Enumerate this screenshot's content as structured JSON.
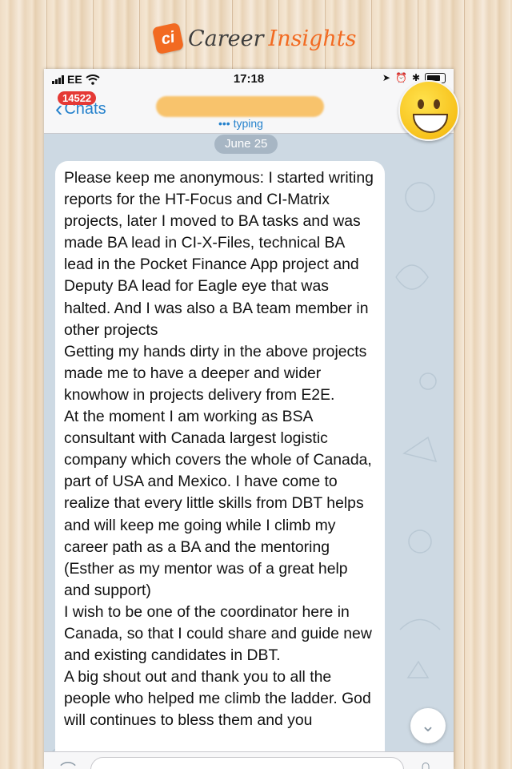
{
  "brand": {
    "badge": "ci",
    "word1": "Career",
    "word2": "Insights"
  },
  "status_bar": {
    "carrier": "EE",
    "time": "17:18"
  },
  "nav": {
    "badge_count": "14522",
    "back_label": "Chats",
    "status": "typing"
  },
  "chat": {
    "date": "June 25",
    "message": "Please keep me anonymous: I started writing reports for the HT-Focus and CI-Matrix projects, later I moved to BA tasks and was made BA lead in CI-X-Files, technical BA lead in the Pocket Finance App project and Deputy BA lead for Eagle eye that was halted. And I was also a BA team member in other projects\nGetting my hands dirty in the above projects made me to have a deeper and wider knowhow in projects delivery from E2E.\nAt the moment I am working as BSA consultant with Canada largest logistic company which covers the whole of Canada, part of USA and Mexico. I have come to realize that every little skills from DBT helps and will keep me going while I climb my career path as a BA and the mentoring (Esther as my mentor was of a great help and support)\nI wish to be one of the coordinator here in Canada, so that I could share and guide new and existing candidates in DBT.\nA big shout out and thank you to all the people who helped me climb the ladder. God will continues to bless them and you"
  },
  "icons": {
    "back": "chevron-left-icon",
    "scroll": "chevron-down-icon",
    "attach": "paperclip-icon",
    "mic": "microphone-icon",
    "wifi": "wifi-icon",
    "battery": "battery-icon"
  },
  "colors": {
    "brand_orange": "#f26a21",
    "accent_blue": "#2481cc",
    "badge_red": "#e53935"
  }
}
